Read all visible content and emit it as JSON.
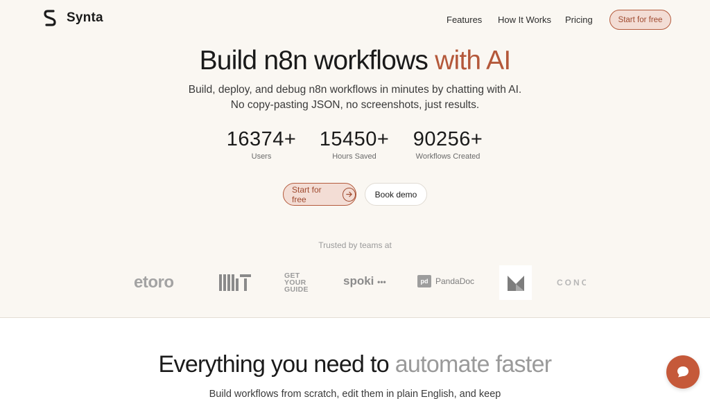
{
  "brand": {
    "name": "Synta",
    "icon": "synta-s-logo-icon"
  },
  "nav": {
    "links": [
      "Features",
      "How It Works",
      "Pricing"
    ],
    "cta": "Start for free"
  },
  "hero": {
    "title_main": "Build n8n workflows",
    "title_accent": "with AI",
    "subtitle_line1": "Build, deploy, and debug n8n workflows in minutes by chatting with AI.",
    "subtitle_line2": "No copy-pasting JSON, no screenshots, just results.",
    "stats": [
      {
        "value": "16374+",
        "label": "Users"
      },
      {
        "value": "15450+",
        "label": "Hours Saved"
      },
      {
        "value": "90256+",
        "label": "Workflows Created"
      }
    ],
    "primary_cta": "Start for free",
    "primary_cta_icon": "arrow-right-icon",
    "secondary_cta": "Book demo"
  },
  "trusted": {
    "label": "Trusted by teams at",
    "logos": [
      "etoro",
      "MIT",
      "GET YOUR GUIDE",
      "spoki",
      "PandaDoc",
      "M",
      "CONC"
    ]
  },
  "features_section": {
    "title_main": "Everything you need to",
    "title_muted": "automate faster",
    "subtitle": "Build workflows from scratch, edit them in plain English, and keep"
  },
  "chat_widget": {
    "icon": "chat-bubble-icon"
  },
  "colors": {
    "accent": "#b4583a",
    "hero_bg": "#faf7f2",
    "cta_bg": "#f3ddd5",
    "chat_button": "#c5593a"
  }
}
